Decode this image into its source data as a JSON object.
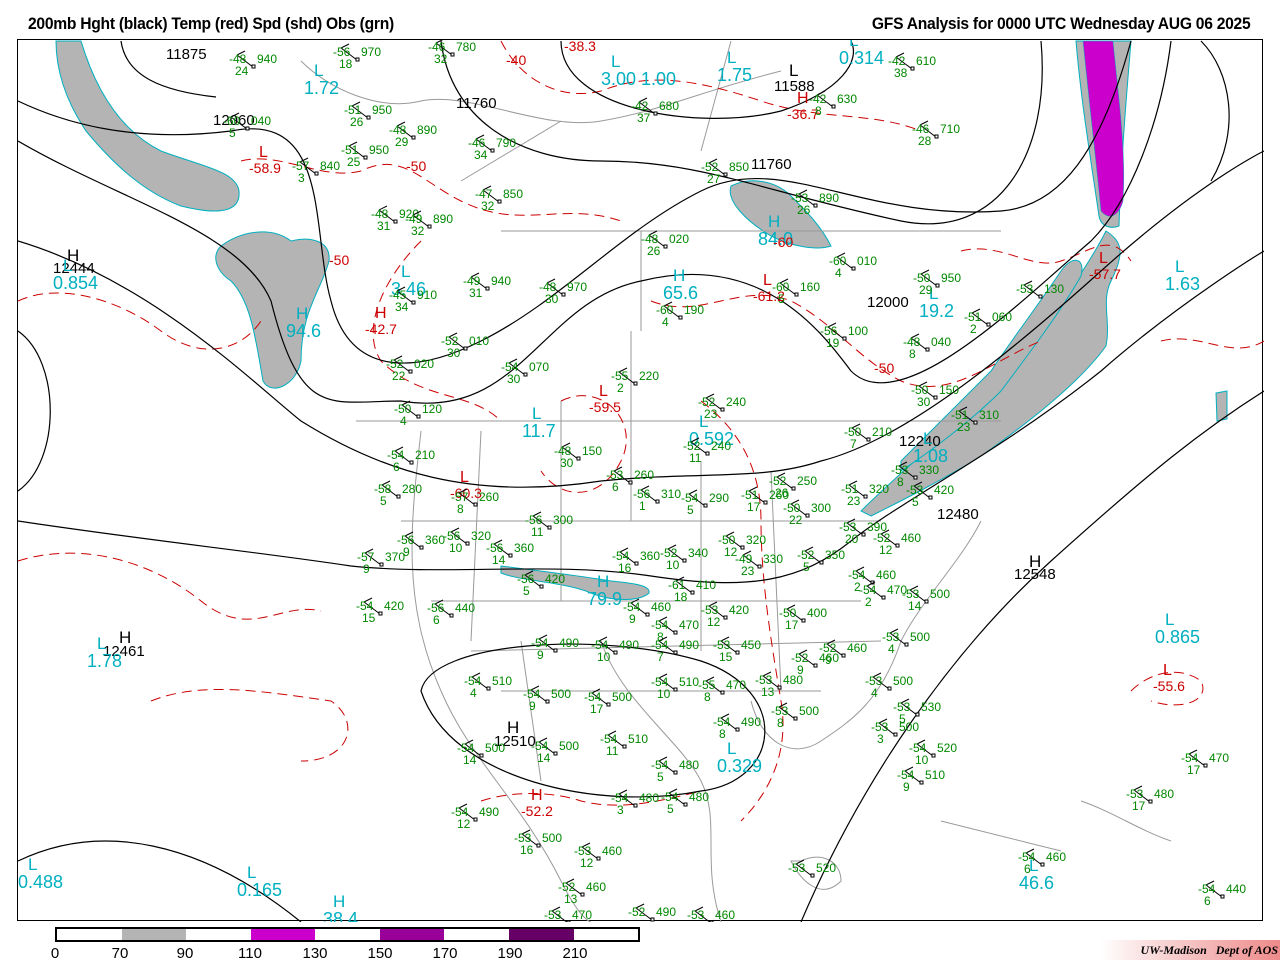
{
  "header": {
    "title_left": "200mb Hght (black) Temp (red) Spd (shd) Obs (grn)",
    "title_right": "GFS Analysis for 0000 UTC Wednesday  AUG 06 2025"
  },
  "colorbar": {
    "labels": [
      "0",
      "70",
      "90",
      "110",
      "130",
      "150",
      "170",
      "190",
      "210"
    ],
    "colors": [
      "#ffffff",
      "#b4b4b4",
      "#ffffff",
      "#cc00cc",
      "#ffffff",
      "#990099",
      "#ffffff",
      "#660066",
      "#ffffff"
    ]
  },
  "footer": {
    "credit": "UW-Madison   Dept of AOS"
  },
  "colors": {
    "height": "#000000",
    "temp": "#cc0000",
    "speed": "#00b0c0",
    "obs": "#008800",
    "shade_70": "#b4b4b4",
    "shade_110": "#cc00cc",
    "border": "#9a9a9a"
  },
  "map": {
    "height_labels": [
      "11875",
      "11760",
      "12060",
      "11760",
      "12444",
      "12000",
      "12480",
      "12548",
      "12461",
      "12510",
      "11588",
      "12240"
    ],
    "height_centers": [
      {
        "type": "H",
        "value": "12444"
      },
      {
        "type": "L",
        "value": "11588"
      },
      {
        "type": "H",
        "value": "12548"
      },
      {
        "type": "H",
        "value": "12461"
      },
      {
        "type": "H",
        "value": "12510"
      }
    ],
    "speed_centers": [
      {
        "type": "L",
        "value": "1.72"
      },
      {
        "type": "L",
        "value": "1.75"
      },
      {
        "type": "L",
        "value": "3.00 1.00"
      },
      {
        "type": "L",
        "value": "0.314"
      },
      {
        "type": "L",
        "value": "0.854"
      },
      {
        "type": "L",
        "value": "3.46"
      },
      {
        "type": "H",
        "value": "94.6"
      },
      {
        "type": "H",
        "value": "65.6"
      },
      {
        "type": "H",
        "value": "84.0"
      },
      {
        "type": "L",
        "value": "11.7"
      },
      {
        "type": "L",
        "value": "0.592"
      },
      {
        "type": "L",
        "value": "1.08"
      },
      {
        "type": "H",
        "value": "79.9"
      },
      {
        "type": "L",
        "value": "0.329"
      },
      {
        "type": "L",
        "value": "0.865"
      },
      {
        "type": "L",
        "value": "1.63"
      },
      {
        "type": "L",
        "value": "19.2"
      },
      {
        "type": "L",
        "value": "1.78"
      },
      {
        "type": "L",
        "value": "0.488"
      },
      {
        "type": "L",
        "value": "0.165"
      },
      {
        "type": "L",
        "value": "46.6"
      },
      {
        "type": "H",
        "value": "38.4"
      }
    ],
    "temp_labels": [
      {
        "type": "",
        "value": "-38.3"
      },
      {
        "type": "",
        "value": "-40"
      },
      {
        "type": "L",
        "value": "-58.9"
      },
      {
        "type": "",
        "value": "-50"
      },
      {
        "type": "",
        "value": "-50"
      },
      {
        "type": "H",
        "value": "-42.7"
      },
      {
        "type": "L",
        "value": "-59.5"
      },
      {
        "type": "L",
        "value": "-60.3"
      },
      {
        "type": "L",
        "value": "-61.2"
      },
      {
        "type": "",
        "value": "-50"
      },
      {
        "type": "L",
        "value": "-57.7"
      },
      {
        "type": "L",
        "value": "-55.6"
      },
      {
        "type": "H",
        "value": "-52.2"
      },
      {
        "type": "H",
        "value": "-36.7"
      },
      {
        "type": "",
        "value": "-60"
      }
    ],
    "obs": [
      {
        "t": "-56",
        "h": "970",
        "d": "18"
      },
      {
        "t": "-48",
        "h": "940",
        "d": "24"
      },
      {
        "t": "-46",
        "h": "780",
        "d": "32"
      },
      {
        "t": "-51",
        "h": "950",
        "d": "26"
      },
      {
        "t": "-48",
        "h": "890",
        "d": "29"
      },
      {
        "t": "-60",
        "h": "040",
        "d": "5"
      },
      {
        "t": "-51",
        "h": "950",
        "d": "25"
      },
      {
        "t": "-57",
        "h": "840",
        "d": "3"
      },
      {
        "t": "-46",
        "h": "790",
        "d": "34"
      },
      {
        "t": "-47",
        "h": "850",
        "d": "32"
      },
      {
        "t": "-48",
        "h": "920",
        "d": "31"
      },
      {
        "t": "-49",
        "h": "890",
        "d": "32"
      },
      {
        "t": "-49",
        "h": "940",
        "d": "31"
      },
      {
        "t": "-48",
        "h": "970",
        "d": "30"
      },
      {
        "t": "-45",
        "h": "910",
        "d": "34"
      },
      {
        "t": "-48",
        "h": "020",
        "d": "26"
      },
      {
        "t": "-60",
        "h": "190",
        "d": "4"
      },
      {
        "t": "-60",
        "h": "160",
        "d": "5"
      },
      {
        "t": "-60",
        "h": "010",
        "d": "4"
      },
      {
        "t": "-50",
        "h": "950",
        "d": "29"
      },
      {
        "t": "-56",
        "h": "100",
        "d": "19"
      },
      {
        "t": "-52",
        "h": "010",
        "d": "30"
      },
      {
        "t": "-52",
        "h": "020",
        "d": "22"
      },
      {
        "t": "-54",
        "h": "070",
        "d": "30"
      },
      {
        "t": "-55",
        "h": "220",
        "d": "2"
      },
      {
        "t": "-50",
        "h": "120",
        "d": "4"
      },
      {
        "t": "-52",
        "h": "240",
        "d": "23"
      },
      {
        "t": "-52",
        "h": "240",
        "d": "11"
      },
      {
        "t": "-50",
        "h": "210",
        "d": "7"
      },
      {
        "t": "-54",
        "h": "210",
        "d": "6"
      },
      {
        "t": "-48",
        "h": "150",
        "d": "30"
      },
      {
        "t": "-53",
        "h": "260",
        "d": "6"
      },
      {
        "t": "-56",
        "h": "310",
        "d": "1"
      },
      {
        "t": "-54",
        "h": "290",
        "d": "5"
      },
      {
        "t": "-51",
        "h": "260",
        "d": "17"
      },
      {
        "t": "-52",
        "h": "250",
        "d": "26"
      },
      {
        "t": "-58",
        "h": "280",
        "d": "5"
      },
      {
        "t": "-57",
        "h": "260",
        "d": "8"
      },
      {
        "t": "-56",
        "h": "300",
        "d": "11"
      },
      {
        "t": "-50",
        "h": "300",
        "d": "22"
      },
      {
        "t": "-51",
        "h": "320",
        "d": "23"
      },
      {
        "t": "-53",
        "h": "330",
        "d": "8"
      },
      {
        "t": "-53",
        "h": "420",
        "d": "5"
      },
      {
        "t": "-53",
        "h": "390",
        "d": "20"
      },
      {
        "t": "-56",
        "h": "360",
        "d": "9"
      },
      {
        "t": "-56",
        "h": "320",
        "d": "10"
      },
      {
        "t": "-57",
        "h": "370",
        "d": "9"
      },
      {
        "t": "-56",
        "h": "360",
        "d": "14"
      },
      {
        "t": "-54",
        "h": "360",
        "d": "16"
      },
      {
        "t": "-52",
        "h": "340",
        "d": "10"
      },
      {
        "t": "-50",
        "h": "320",
        "d": "12"
      },
      {
        "t": "-49",
        "h": "330",
        "d": "23"
      },
      {
        "t": "-52",
        "h": "350",
        "d": "5"
      },
      {
        "t": "-52",
        "h": "460",
        "d": "12"
      },
      {
        "t": "-56",
        "h": "420",
        "d": "5"
      },
      {
        "t": "-61",
        "h": "410",
        "d": "18"
      },
      {
        "t": "-54",
        "h": "460",
        "d": "9"
      },
      {
        "t": "-53",
        "h": "420",
        "d": "12"
      },
      {
        "t": "-54",
        "h": "420",
        "d": "15"
      },
      {
        "t": "-56",
        "h": "440",
        "d": "6"
      },
      {
        "t": "-54",
        "h": "470",
        "d": "8"
      },
      {
        "t": "-50",
        "h": "400",
        "d": "17"
      },
      {
        "t": "-54",
        "h": "460",
        "d": "2"
      },
      {
        "t": "-54",
        "h": "470",
        "d": "2"
      },
      {
        "t": "-53",
        "h": "500",
        "d": "14"
      },
      {
        "t": "-54",
        "h": "490",
        "d": "9"
      },
      {
        "t": "-54",
        "h": "490",
        "d": "10"
      },
      {
        "t": "-54",
        "h": "490",
        "d": "7"
      },
      {
        "t": "-53",
        "h": "450",
        "d": "15"
      },
      {
        "t": "-52",
        "h": "460",
        "d": "9"
      },
      {
        "t": "-52",
        "h": "460",
        "d": "9"
      },
      {
        "t": "-53",
        "h": "500",
        "d": "4"
      },
      {
        "t": "-54",
        "h": "510",
        "d": "4"
      },
      {
        "t": "-54",
        "h": "500",
        "d": "9"
      },
      {
        "t": "-54",
        "h": "500",
        "d": "17"
      },
      {
        "t": "-54",
        "h": "510",
        "d": "10"
      },
      {
        "t": "-55",
        "h": "470",
        "d": "8"
      },
      {
        "t": "-53",
        "h": "480",
        "d": "13"
      },
      {
        "t": "-53",
        "h": "500",
        "d": "4"
      },
      {
        "t": "-53",
        "h": "530",
        "d": "5"
      },
      {
        "t": "-54",
        "h": "490",
        "d": "8"
      },
      {
        "t": "-53",
        "h": "500",
        "d": "8"
      },
      {
        "t": "-53",
        "h": "500",
        "d": "3"
      },
      {
        "t": "-54",
        "h": "500",
        "d": "14"
      },
      {
        "t": "-54",
        "h": "500",
        "d": "14"
      },
      {
        "t": "-54",
        "h": "510",
        "d": "11"
      },
      {
        "t": "-54",
        "h": "520",
        "d": "10"
      },
      {
        "t": "-54",
        "h": "480",
        "d": "5"
      },
      {
        "t": "-54",
        "h": "510",
        "d": "9"
      },
      {
        "t": "-54",
        "h": "470",
        "d": "17"
      },
      {
        "t": "-53",
        "h": "480",
        "d": "17"
      },
      {
        "t": "-54",
        "h": "480",
        "d": "3"
      },
      {
        "t": "-54",
        "h": "480",
        "d": "5"
      },
      {
        "t": "-54",
        "h": "490",
        "d": "12"
      },
      {
        "t": "-53",
        "h": "500",
        "d": "16"
      },
      {
        "t": "-53",
        "h": "460",
        "d": "12"
      },
      {
        "t": "-52",
        "h": "460",
        "d": "13"
      },
      {
        "t": "-53",
        "h": "520",
        "d": ""
      },
      {
        "t": "-54",
        "h": "460",
        "d": "6"
      },
      {
        "t": "-54",
        "h": "440",
        "d": "6"
      },
      {
        "t": "-53",
        "h": "470",
        "d": ""
      },
      {
        "t": "-52",
        "h": "490",
        "d": ""
      },
      {
        "t": "-53",
        "h": "460",
        "d": ""
      },
      {
        "t": "-42",
        "h": "610",
        "d": "38"
      },
      {
        "t": "-42",
        "h": "630",
        "d": "8"
      },
      {
        "t": "-42",
        "h": "680",
        "d": "37"
      },
      {
        "t": "-46",
        "h": "710",
        "d": "28"
      },
      {
        "t": "-52",
        "h": "850",
        "d": "27"
      },
      {
        "t": "-53",
        "h": "890",
        "d": "26"
      },
      {
        "t": "-51",
        "h": "060",
        "d": "2"
      },
      {
        "t": "-48",
        "h": "040",
        "d": "8"
      },
      {
        "t": "-50",
        "h": "150",
        "d": "30"
      },
      {
        "t": "-51",
        "h": "310",
        "d": "23"
      },
      {
        "t": "-53",
        "h": "130",
        "d": ""
      }
    ]
  }
}
